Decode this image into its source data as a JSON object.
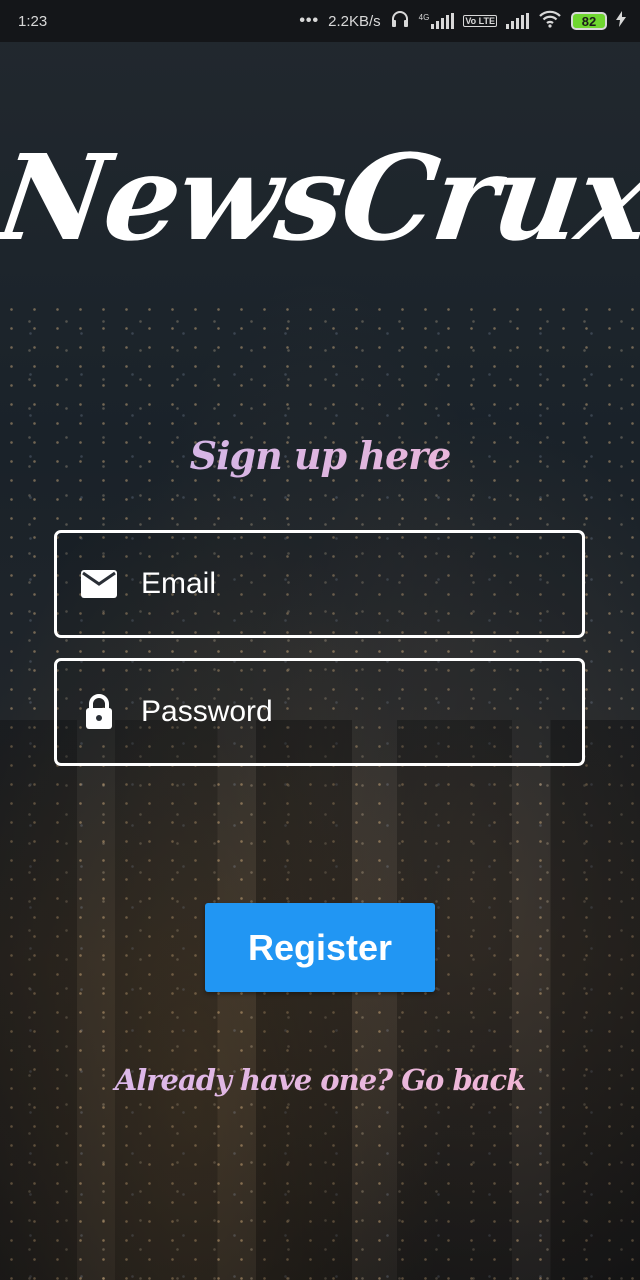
{
  "status_bar": {
    "time": "1:23",
    "net_speed": "2.2KB/s",
    "net_type": "4G",
    "volte": "Vo LTE",
    "battery": "82"
  },
  "app": {
    "title": "NewsCrux",
    "subtitle": "Sign up here"
  },
  "form": {
    "email_label": "Email",
    "password_label": "Password",
    "register_label": "Register",
    "go_back_label": "Already have one? Go back"
  },
  "colors": {
    "button": "#2196f3",
    "subtitle_tint": "#e8b6df",
    "battery_fill": "#6fd62f"
  },
  "icons": [
    "email-icon",
    "lock-icon",
    "headphones-icon",
    "wifi-icon",
    "charging-icon"
  ]
}
